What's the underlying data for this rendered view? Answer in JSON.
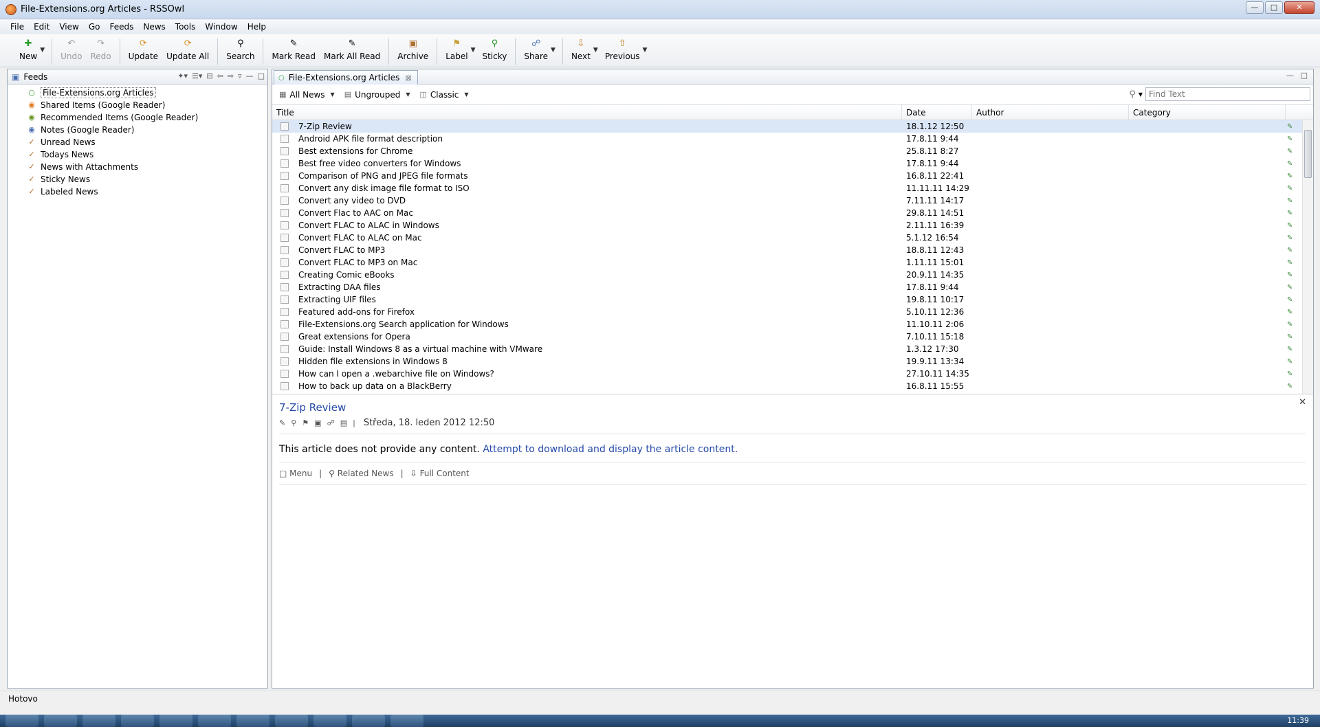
{
  "window": {
    "title": "File-Extensions.org Articles - RSSOwl"
  },
  "menubar": [
    "File",
    "Edit",
    "View",
    "Go",
    "Feeds",
    "News",
    "Tools",
    "Window",
    "Help"
  ],
  "toolbar": {
    "new": "New",
    "undo": "Undo",
    "redo": "Redo",
    "update": "Update",
    "update_all": "Update All",
    "search": "Search",
    "mark_read": "Mark Read",
    "mark_all_read": "Mark All Read",
    "archive": "Archive",
    "label": "Label",
    "sticky": "Sticky",
    "share": "Share",
    "next": "Next",
    "previous": "Previous"
  },
  "feeds": {
    "header": "Feeds",
    "items": [
      "File-Extensions.org Articles",
      "Shared Items (Google Reader)",
      "Recommended Items (Google Reader)",
      "Notes (Google Reader)",
      "Unread News",
      "Todays News",
      "News with Attachments",
      "Sticky News",
      "Labeled News"
    ]
  },
  "tab": {
    "label": "File-Extensions.org Articles"
  },
  "filter": {
    "news": "All News",
    "grouping": "Ungrouped",
    "layout": "Classic",
    "find_placeholder": "Find Text"
  },
  "columns": {
    "title": "Title",
    "date": "Date",
    "author": "Author",
    "category": "Category"
  },
  "articles": [
    {
      "title": "7-Zip Review",
      "date": "18.1.12 12:50"
    },
    {
      "title": "Android APK file format description",
      "date": "17.8.11 9:44"
    },
    {
      "title": "Best extensions for Chrome",
      "date": "25.8.11 8:27"
    },
    {
      "title": "Best free video converters for Windows",
      "date": "17.8.11 9:44"
    },
    {
      "title": "Comparison of PNG and JPEG file formats",
      "date": "16.8.11 22:41"
    },
    {
      "title": "Convert any disk image file format to ISO",
      "date": "11.11.11 14:29"
    },
    {
      "title": "Convert any video to DVD",
      "date": "7.11.11 14:17"
    },
    {
      "title": "Convert Flac to AAC on Mac",
      "date": "29.8.11 14:51"
    },
    {
      "title": "Convert FLAC to ALAC in Windows",
      "date": "2.11.11 16:39"
    },
    {
      "title": "Convert FLAC to ALAC on Mac",
      "date": "5.1.12 16:54"
    },
    {
      "title": "Convert FLAC to MP3",
      "date": "18.8.11 12:43"
    },
    {
      "title": "Convert FLAC to MP3 on Mac",
      "date": "1.11.11 15:01"
    },
    {
      "title": "Creating Comic eBooks",
      "date": "20.9.11 14:35"
    },
    {
      "title": "Extracting DAA files",
      "date": "17.8.11 9:44"
    },
    {
      "title": "Extracting UIF files",
      "date": "19.8.11 10:17"
    },
    {
      "title": "Featured add-ons for Firefox",
      "date": "5.10.11 12:36"
    },
    {
      "title": "File-Extensions.org Search application for Windows",
      "date": "11.10.11 2:06"
    },
    {
      "title": "Great extensions for Opera",
      "date": "7.10.11 15:18"
    },
    {
      "title": "Guide: Install Windows 8 as a virtual machine with VMware",
      "date": "1.3.12 17:30"
    },
    {
      "title": "Hidden file extensions in Windows 8",
      "date": "19.9.11 13:34"
    },
    {
      "title": "How can I open a .webarchive file on Windows?",
      "date": "27.10.11 14:35"
    },
    {
      "title": "How to back up data on a BlackBerry",
      "date": "16.8.11 15:55"
    }
  ],
  "article": {
    "title": "7-Zip Review",
    "date": "Středa, 18. leden 2012 12:50",
    "body_text": "This article does not provide any content.",
    "body_link": "Attempt to download and display the article content.",
    "footer": {
      "menu": "Menu",
      "related": "Related News",
      "full": "Full Content"
    }
  },
  "status": {
    "text": "Hotovo"
  },
  "clock": "11:39"
}
